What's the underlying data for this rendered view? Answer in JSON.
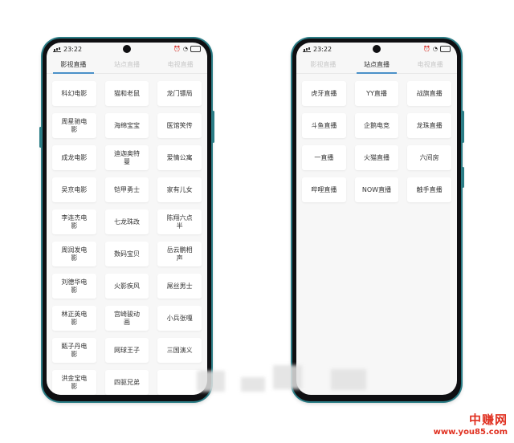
{
  "status": {
    "time": "23:22"
  },
  "left_phone": {
    "tabs": [
      {
        "label": "影视直播",
        "active": true
      },
      {
        "label": "站点直播",
        "active": false
      },
      {
        "label": "电视直播",
        "active": false
      }
    ],
    "items": [
      "科幻电影",
      "猫和老鼠",
      "龙门镖局",
      "周星驰电影",
      "海绵宝宝",
      "医馆笑传",
      "成龙电影",
      "迪迦奥特曼",
      "爱情公寓",
      "吴京电影",
      "铠甲勇士",
      "家有儿女",
      "李连杰电影",
      "七龙珠改",
      "陈翔六点半",
      "周润发电影",
      "数码宝贝",
      "岳云鹏相声",
      "刘德华电影",
      "火影疾风",
      "屌丝男士",
      "林正英电影",
      "宫崎骏动画",
      "小兵张嘎",
      "甄子丹电影",
      "网球王子",
      "三国演义",
      "洪金宝电影",
      "四驱兄弟",
      ""
    ]
  },
  "right_phone": {
    "tabs": [
      {
        "label": "影视直播",
        "active": false
      },
      {
        "label": "站点直播",
        "active": true
      },
      {
        "label": "电视直播",
        "active": false
      }
    ],
    "items": [
      "虎牙直播",
      "YY直播",
      "战旗直播",
      "斗鱼直播",
      "企鹅电竞",
      "龙珠直播",
      "一直播",
      "火猫直播",
      "六间房",
      "哔哩直播",
      "NOW直播",
      "触手直播"
    ]
  },
  "watermark": {
    "top": "中赚网",
    "bottom": "www.you85.com"
  }
}
